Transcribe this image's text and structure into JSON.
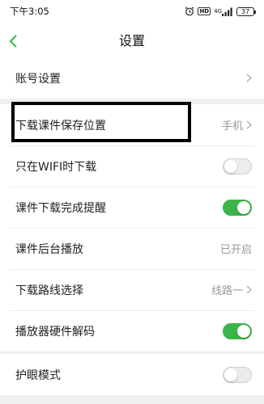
{
  "status_bar": {
    "time": "下午3:05",
    "hd_badge": "HD",
    "network": "4G",
    "battery": "37"
  },
  "nav": {
    "title": "设置",
    "back_icon": "chevron-left-icon"
  },
  "account": {
    "label": "账号设置"
  },
  "download_settings": [
    {
      "label": "下载课件保存位置",
      "value": "手机",
      "control": "chevron"
    },
    {
      "label": "只在WIFI时下载",
      "control": "toggle",
      "on": false
    },
    {
      "label": "课件下载完成提醒",
      "control": "toggle",
      "on": true
    },
    {
      "label": "课件后台播放",
      "value": "已开启",
      "control": "text"
    },
    {
      "label": "下载路线选择",
      "value": "线路一",
      "control": "chevron"
    },
    {
      "label": "播放器硬件解码",
      "control": "toggle",
      "on": true
    }
  ],
  "eye_care": {
    "label": "护眼模式",
    "on": false
  },
  "colors": {
    "accent_green": "#3bb44a",
    "back_icon_green": "#3bb44a"
  }
}
